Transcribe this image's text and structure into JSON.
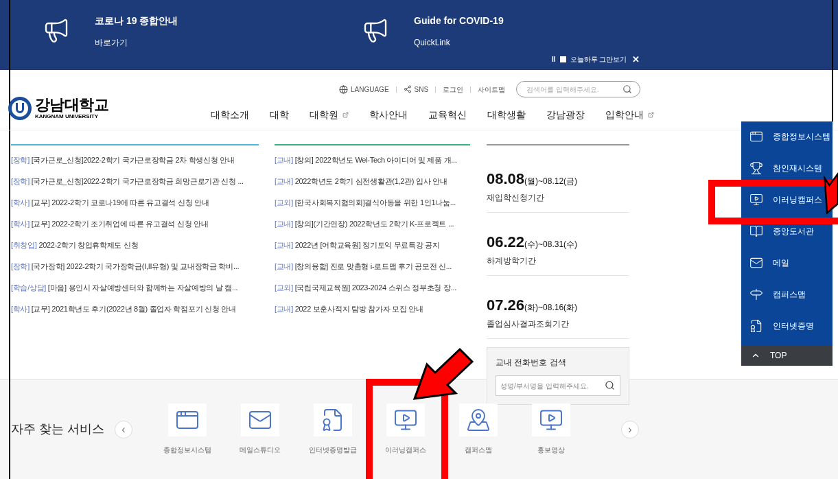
{
  "banner": {
    "items": [
      {
        "title": "코로나 19 종합안내",
        "link": "바로가기"
      },
      {
        "title": "Guide for COVID-19",
        "link": "QuickLink"
      }
    ],
    "controls": {
      "pause": "II",
      "stop_label": "오늘하루 그만보기",
      "checked": false,
      "close": "✕"
    }
  },
  "header": {
    "utility": [
      {
        "label": "LANGUAGE",
        "kind": "globe"
      },
      {
        "label": "SNS",
        "kind": "share"
      },
      {
        "label": "로그인",
        "kind": "text"
      },
      {
        "label": "사이트맵",
        "kind": "text"
      }
    ],
    "search": {
      "placeholder": "검색어를 입력해주세요."
    },
    "logo": {
      "name": "강남대학교",
      "sub": "KANGNAM UNIVERSITY"
    },
    "nav": [
      {
        "label": "대학소개",
        "external": false
      },
      {
        "label": "대학",
        "external": false
      },
      {
        "label": "대학원",
        "external": true
      },
      {
        "label": "학사안내",
        "external": false
      },
      {
        "label": "교육혁신",
        "external": false
      },
      {
        "label": "대학생활",
        "external": false
      },
      {
        "label": "강남광장",
        "external": false
      },
      {
        "label": "입학안내",
        "external": true
      }
    ]
  },
  "notices": [
    {
      "tag": "[장학]",
      "title": "[국가근로_신청]2022-2학기 국가근로장학금 2차 학생신청 안내"
    },
    {
      "tag": "[장학]",
      "title": "[국가근로_신청]2022-2학기 국가근로장학금 희망근로기관 신청 ..."
    },
    {
      "tag": "[학사]",
      "title": "[교무] 2022-2학기 코로나19에 따른 유고결석 신청 안내"
    },
    {
      "tag": "[학사]",
      "title": "[교무] 2022-2학기 조기취업에 따른 유고결석 신청 안내"
    },
    {
      "tag": "[취창업]",
      "title": "2022-2학기 창업휴학제도 신청"
    },
    {
      "tag": "[장학]",
      "title": "[국가장학] 2022-2학기 국가장학금(I,II유형) 및 교내장학금 학비..."
    },
    {
      "tag": "[학습/상담]",
      "title": "[마음] 용인시 자살예방센터와 함께하는 자살예방의 날 캠..."
    },
    {
      "tag": "[학사]",
      "title": "[교무] 2021학년도 후기(2022년 8월) 졸업자 학점포기 신청 안내"
    }
  ],
  "events": [
    {
      "tag": "[교내]",
      "title": "[창의] 2022학년도 Wel-Tech 아이디어 및 제품 개..."
    },
    {
      "tag": "[교내]",
      "title": "2022학년도 2학기 심전생활관(1,2관) 입사 안내"
    },
    {
      "tag": "[교외]",
      "title": "[한국사회복지협의회]결식아동을 위한 1인1나눔..."
    },
    {
      "tag": "[교내]",
      "title": "[창의](기간연장) 2022학년도 2학기 K-프로젝트 ..."
    },
    {
      "tag": "[교내]",
      "title": "2022년 [어학교육원] 정기토익 무료특강 공지"
    },
    {
      "tag": "[교내]",
      "title": "[창의융합] 진로 맞춤형 i-로드맵 후기 공모전 신..."
    },
    {
      "tag": "[교외]",
      "title": "[국립국제교육원] 2023-2024 스위스 정부초청 장..."
    },
    {
      "tag": "[교내]",
      "title": "2022 보훈사적지 탐방 참가자 모집 안내"
    }
  ],
  "schedule": [
    {
      "start": "08.08",
      "range": "(월)~08.12(금)",
      "label": "재입학신청기간"
    },
    {
      "start": "06.22",
      "range": "(수)~08.31(수)",
      "label": "하계방학기간"
    },
    {
      "start": "07.26",
      "range": "(화)~08.16(화)",
      "label": "졸업심사결과조회기간"
    }
  ],
  "phone_search": {
    "title": "교내 전화번호 검색",
    "placeholder": "성명/부서명을 입력해주세요."
  },
  "quick_menu": {
    "items": [
      {
        "label": "종합정보시스템",
        "kind": "window"
      },
      {
        "label": "참인재시스템",
        "kind": "trophy"
      },
      {
        "label": "이러닝캠퍼스",
        "kind": "elearn"
      },
      {
        "label": "중앙도서관",
        "kind": "book"
      },
      {
        "label": "메일",
        "kind": "mail"
      },
      {
        "label": "캠퍼스맵",
        "kind": "sign"
      },
      {
        "label": "인터넷증명",
        "kind": "cert"
      }
    ],
    "top": "TOP"
  },
  "services": {
    "title": "자주 찾는 서비스",
    "prev": "‹",
    "next": "›",
    "items": [
      {
        "label": "종합정보시스템",
        "kind": "window"
      },
      {
        "label": "메일스튜디오",
        "kind": "mail"
      },
      {
        "label": "인터넷증명발급",
        "kind": "cert"
      },
      {
        "label": "이러닝캠퍼스",
        "kind": "elearn"
      },
      {
        "label": "캠퍼스맵",
        "kind": "map"
      },
      {
        "label": "홍보영상",
        "kind": "video"
      }
    ]
  }
}
